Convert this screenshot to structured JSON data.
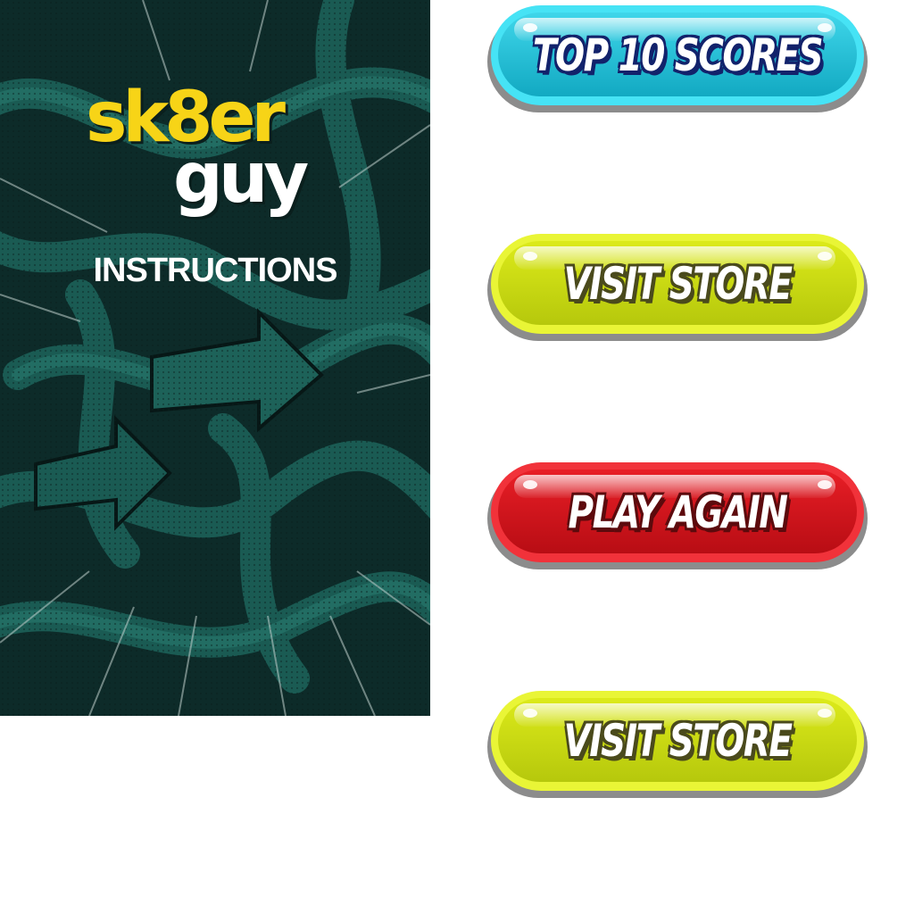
{
  "game": {
    "logo_line1": "sk8er",
    "logo_line2": "guy",
    "instructions_label": "INSTRUCTIONS"
  },
  "buttons": [
    {
      "label": "TOP 10 SCORES",
      "color": "blue"
    },
    {
      "label": "VISIT STORE",
      "color": "yellow"
    },
    {
      "label": "PLAY AGAIN",
      "color": "red"
    },
    {
      "label": "VISIT STORE",
      "color": "yellow"
    }
  ],
  "colors": {
    "panel_bg": "#0b2624",
    "graffiti": "#17564f",
    "logo_yellow": "#f7d417",
    "button_blue": "#12a9c2",
    "button_yellow": "#dcea1a",
    "button_red": "#e81e26"
  }
}
